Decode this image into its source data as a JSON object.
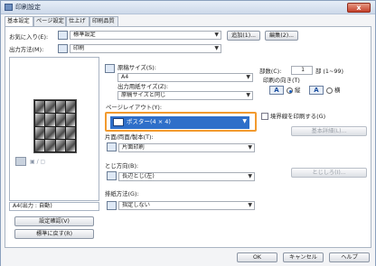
{
  "window": {
    "title": "印刷設定",
    "close": "x"
  },
  "tabs": [
    "基本設定",
    "ページ設定",
    "仕上げ",
    "印刷品質"
  ],
  "favorites": {
    "label": "お気に入り(E):",
    "value": "標準設定",
    "add_btn": "追加(1)...",
    "edit_btn": "編集(2)..."
  },
  "output": {
    "label": "出力方法(M):",
    "value": "印刷"
  },
  "paper": {
    "orig_label": "原稿サイズ(S):",
    "orig_value": "A4",
    "out_label": "出力用紙サイズ(Z):",
    "out_value": "原稿サイズと同じ"
  },
  "copies": {
    "label": "部数(C):",
    "value": "1",
    "unit": "部 (1~99)"
  },
  "orientation": {
    "label": "印刷の向き(T)",
    "portrait_icon": "A",
    "portrait": "縦",
    "landscape_icon": "A",
    "landscape": "横"
  },
  "page_layout": {
    "label": "ページレイアウト(Y):",
    "value": "ポスター(4 × 4)"
  },
  "border": {
    "label": "境界線を印刷する(G)"
  },
  "detail_btn": "基本詳細(L)...",
  "duplex": {
    "label": "片面/両面/製本(T):",
    "value": "片面印刷"
  },
  "binding": {
    "label": "とじ方向(B):",
    "value": "長辺とじ(左)",
    "margin_btn": "とじしろ(I)..."
  },
  "finish": {
    "label": "排紙方法(G):",
    "value": "指定しない"
  },
  "preview": {
    "size_text": "A4(出力 : 自動)",
    "confirm_btn": "設定確認(V)",
    "reset_btn": "標準に戻す(R)"
  },
  "footer": {
    "ok": "OK",
    "cancel": "キャンセル",
    "help": "ヘルプ"
  },
  "colors": {
    "accent": "#2f6fc9",
    "highlight": "#f29a2e"
  }
}
